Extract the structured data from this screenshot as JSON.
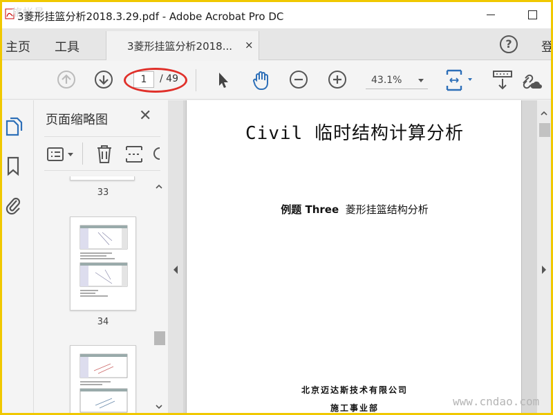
{
  "window": {
    "title": "3菱形挂篮分析2018.3.29.pdf - Adobe Acrobat Pro DC",
    "watermark_top": "旅帐号"
  },
  "menubar": {
    "home": "主页",
    "tools": "工具",
    "tab_label": "3菱形挂篮分析2018...",
    "tab_close": "×",
    "help": "?",
    "login_partial": "登"
  },
  "toolbar": {
    "current_page": "1",
    "total_pages": "/ 49",
    "zoom": "43.1%",
    "accent_color": "#2d6fb8",
    "annotation_color": "#e0302a"
  },
  "thumbnail_panel": {
    "title": "页面缩略图",
    "close": "✕",
    "thumbnails": [
      {
        "label": "33"
      },
      {
        "label": "34"
      }
    ]
  },
  "document": {
    "title": "Civil 临时结构计算分析",
    "subtitle_bold": "例题 Three",
    "subtitle_rest": "菱形挂篮结构分析",
    "company": "北京迈达斯技术有限公司",
    "department": "施工事业部"
  },
  "watermark": "www.cndao.com"
}
